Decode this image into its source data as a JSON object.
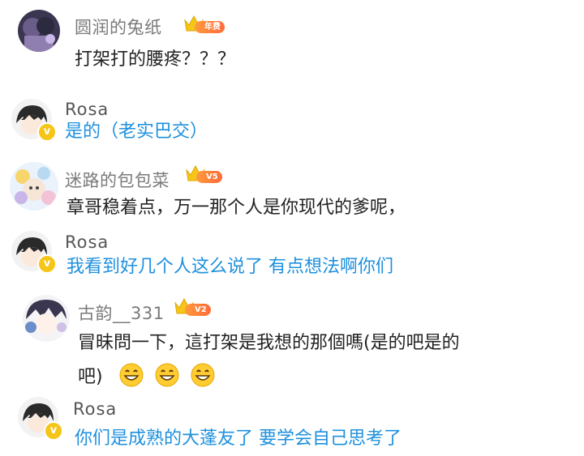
{
  "comments": [
    {
      "username": "圆润的兔纸",
      "badge": "年费",
      "lines": [
        "打架打的腰疼？？？"
      ]
    },
    {
      "username": "Rosa",
      "verified": "v",
      "lines": [
        "是的（老实巴交）"
      ]
    },
    {
      "username": "迷路的包包菜",
      "badge": "V5",
      "lines": [
        "章哥稳着点，万一那个人是你现代的爹呢，"
      ]
    },
    {
      "username": "Rosa",
      "verified": "v",
      "lines": [
        "我看到好几个人这么说了 有点想法啊你们"
      ]
    },
    {
      "username": "古韵__331",
      "badge": "V2",
      "lines": [
        "冒昧問一下，這打架是我想的那個嗎(是的吧是的",
        "吧)"
      ],
      "emojis": [
        "grin-emoji",
        "grin-emoji",
        "grin-emoji"
      ]
    },
    {
      "username": "Rosa",
      "verified": "v",
      "lines": [
        "你们是成熟的大蓬友了 要学会自己思考了"
      ]
    }
  ],
  "colors": {
    "reply_text": "#1e90dd",
    "body_text": "#222222",
    "username": "#7a7a7a",
    "badge_orange": "#ff7a3a",
    "crown_gold": "#f5c518"
  }
}
